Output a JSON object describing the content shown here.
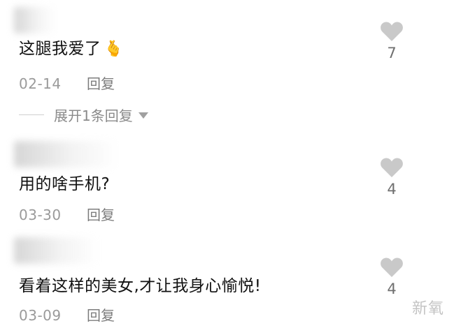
{
  "comments": [
    {
      "text": "这腿我爱了",
      "emoji": "🫰",
      "date": "02-14",
      "reply_label": "回复",
      "likes": "7"
    },
    {
      "text": "用的啥手机?",
      "date": "03-30",
      "reply_label": "回复",
      "likes": "4"
    },
    {
      "text": "看着这样的美女,才让我身心愉悦!",
      "date": "03-09",
      "reply_label": "回复",
      "likes": "4"
    }
  ],
  "expand_replies_label": "展开1条回复",
  "watermark": "新氧",
  "colors": {
    "heart": "#c9c9c9",
    "muted_text": "#9a9a9a"
  }
}
